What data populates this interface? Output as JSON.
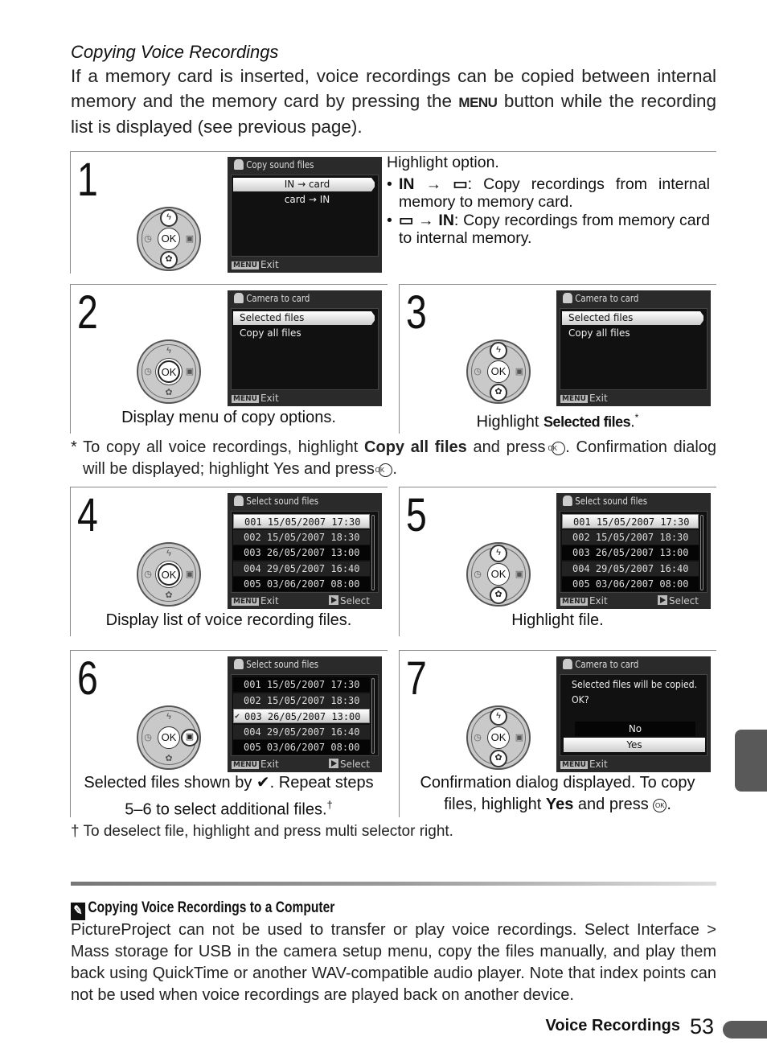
{
  "intro": {
    "title": "Copying Voice Recordings",
    "body_1": "If a memory card is inserted, voice recordings can be copied between internal memory and the memory card by pressing the ",
    "menu_keyword": "MENU",
    "body_2": " button while the recording list is displayed (see previous page)."
  },
  "steps": [
    {
      "number": "1",
      "screen": {
        "title": "Copy sound files",
        "items": [
          "IN → card",
          "card → IN"
        ],
        "highlighted": 0,
        "footer_exit": "Exit"
      },
      "desc_title": "Highlight option.",
      "bullets": [
        {
          "icon": "IN → ▭",
          "text": ": Copy recordings from internal memory to memory card."
        },
        {
          "icon": "▭ → IN",
          "text": ": Copy recordings from memory card to internal memory."
        }
      ],
      "dial_highlight": [
        "up",
        "down"
      ]
    },
    {
      "number": "2",
      "screen": {
        "title": "Camera to card",
        "items": [
          "Selected files",
          "Copy all files"
        ],
        "highlighted": 0,
        "footer_exit": "Exit"
      },
      "caption": "Display menu of copy options.",
      "dial_highlight": [
        "ok"
      ]
    },
    {
      "number": "3",
      "screen": {
        "title": "Camera to card",
        "items": [
          "Selected files",
          "Copy all files"
        ],
        "highlighted": 0,
        "footer_exit": "Exit"
      },
      "caption_prefix": "Highlight ",
      "caption_bold": "Selected files",
      "caption_suffix": ".",
      "caption_mark": "*",
      "dial_highlight": [
        "up",
        "down"
      ]
    },
    {
      "number": "4",
      "screen": {
        "title": "Select sound files",
        "rows": [
          "001  15/05/2007  17:30",
          "002  15/05/2007  18:30",
          "003  26/05/2007  13:00",
          "004  29/05/2007  16:40",
          "005  03/06/2007  08:00"
        ],
        "highlighted": 0,
        "footer_exit": "Exit",
        "footer_select": "Select"
      },
      "caption": "Display list of voice recording files.",
      "dial_highlight": [
        "ok"
      ]
    },
    {
      "number": "5",
      "screen": {
        "title": "Select sound files",
        "rows": [
          "001  15/05/2007  17:30",
          "002  15/05/2007  18:30",
          "003  26/05/2007  13:00",
          "004  29/05/2007  16:40",
          "005  03/06/2007  08:00"
        ],
        "highlighted": 0,
        "footer_exit": "Exit",
        "footer_select": "Select"
      },
      "caption": "Highlight file.",
      "dial_highlight": [
        "up",
        "down"
      ]
    },
    {
      "number": "6",
      "screen": {
        "title": "Select sound files",
        "rows": [
          "001  15/05/2007  17:30",
          "002  15/05/2007  18:30",
          "003  26/05/2007  13:00",
          "004  29/05/2007  16:40",
          "005  03/06/2007  08:00"
        ],
        "highlighted": 2,
        "checked": 2,
        "footer_exit": "Exit",
        "footer_select": "Select"
      },
      "caption_1": "Selected files shown by ✔.  Repeat steps",
      "caption_2": "5–6 to select additional files.",
      "caption_mark": "†",
      "dial_highlight": [
        "right"
      ]
    },
    {
      "number": "7",
      "screen": {
        "title": "Camera to card",
        "message_1": "Selected files will be copied.",
        "message_2": "OK?",
        "options": [
          "No",
          "Yes"
        ],
        "highlighted": 1,
        "footer_exit": "Exit"
      },
      "caption_1": "Confirmation dialog displayed.  To copy",
      "caption_2_prefix": "files, highlight ",
      "caption_2_bold": "Yes",
      "caption_2_suffix": " and press ",
      "caption_2_end": ".",
      "dial_highlight": [
        "up",
        "down"
      ]
    }
  ],
  "dial": {
    "ok_label": "OK",
    "up_icon": "ϟ",
    "down_icon": "✿",
    "left_icon": "◷",
    "right_icon": "▣"
  },
  "screen_common": {
    "menu_key": "MENU",
    "ok_symbol": "OK"
  },
  "footnote_star": {
    "mark": "*",
    "text_1": " To copy all voice recordings, highlight ",
    "bold_1": "Copy all files",
    "text_2": " and press ",
    "text_3": ".  Confirmation dialog will be displayed; highlight ",
    "bold_2": "Yes",
    "text_4": " and press ",
    "text_5": "."
  },
  "footnote_dagger": "† To deselect file, highlight and press multi selector right.",
  "tip": {
    "icon": "pencil-icon",
    "title": "Copying Voice Recordings to a Computer",
    "t1": "PictureProject can not be used to transfer or play voice recordings.  Select ",
    "b1": "Interface",
    "t2": " > ",
    "b2": "Mass storage",
    "t3": " for ",
    "b3": "USB",
    "t4": " in the camera setup menu, copy the files manually, and play them back using QuickTime or another WAV-compatible audio player.  Note that index points can not be used when voice recordings are played back on another device."
  },
  "footer": {
    "section": "Voice Recordings",
    "page": "53"
  },
  "colors": {
    "tab": "#5a5a5a",
    "screen_bg": "#2a2a2a",
    "rule": "#888888"
  }
}
